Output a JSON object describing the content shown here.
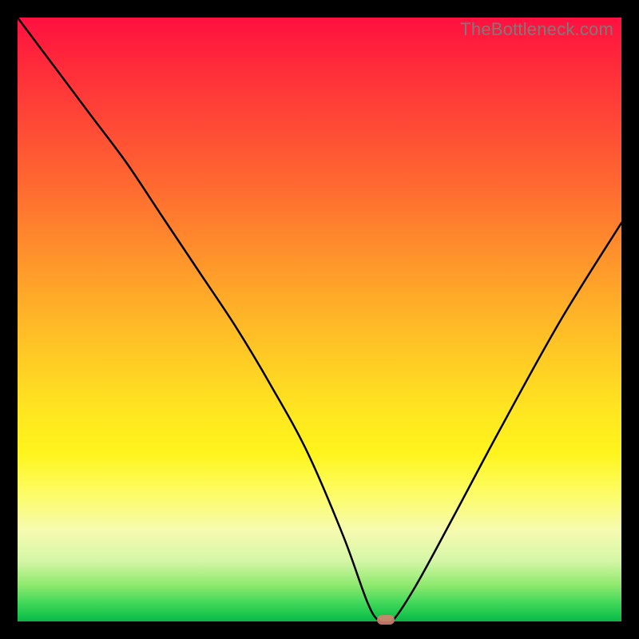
{
  "watermark": "TheBottleneck.com",
  "colors": {
    "frame": "#000000",
    "marker": "#d88272",
    "curve": "#000000"
  },
  "chart_data": {
    "type": "line",
    "title": "",
    "xlabel": "",
    "ylabel": "",
    "xlim": [
      0,
      100
    ],
    "ylim": [
      0,
      100
    ],
    "grid": false,
    "legend": false,
    "annotations": [
      {
        "label": "TheBottleneck.com",
        "x": 100,
        "y": 100,
        "anchor": "top-right"
      }
    ],
    "series": [
      {
        "name": "bottleneck-curve",
        "x": [
          0,
          6,
          12,
          18,
          24,
          30,
          36,
          42,
          48,
          54,
          58,
          60,
          62,
          66,
          72,
          80,
          90,
          100
        ],
        "y": [
          100,
          92,
          84,
          76,
          67,
          58,
          49,
          39,
          28,
          14,
          3,
          0,
          0,
          6,
          17,
          32,
          50,
          66
        ]
      }
    ],
    "marker": {
      "x": 61,
      "y": 0
    },
    "background_gradient": {
      "orientation": "vertical",
      "stops": [
        {
          "pos": 0.0,
          "color": "#ff1040"
        },
        {
          "pos": 0.38,
          "color": "#ff8d2c"
        },
        {
          "pos": 0.66,
          "color": "#ffe820"
        },
        {
          "pos": 0.85,
          "color": "#f6fbb0"
        },
        {
          "pos": 0.97,
          "color": "#3fd85a"
        },
        {
          "pos": 1.0,
          "color": "#0db447"
        }
      ]
    }
  }
}
